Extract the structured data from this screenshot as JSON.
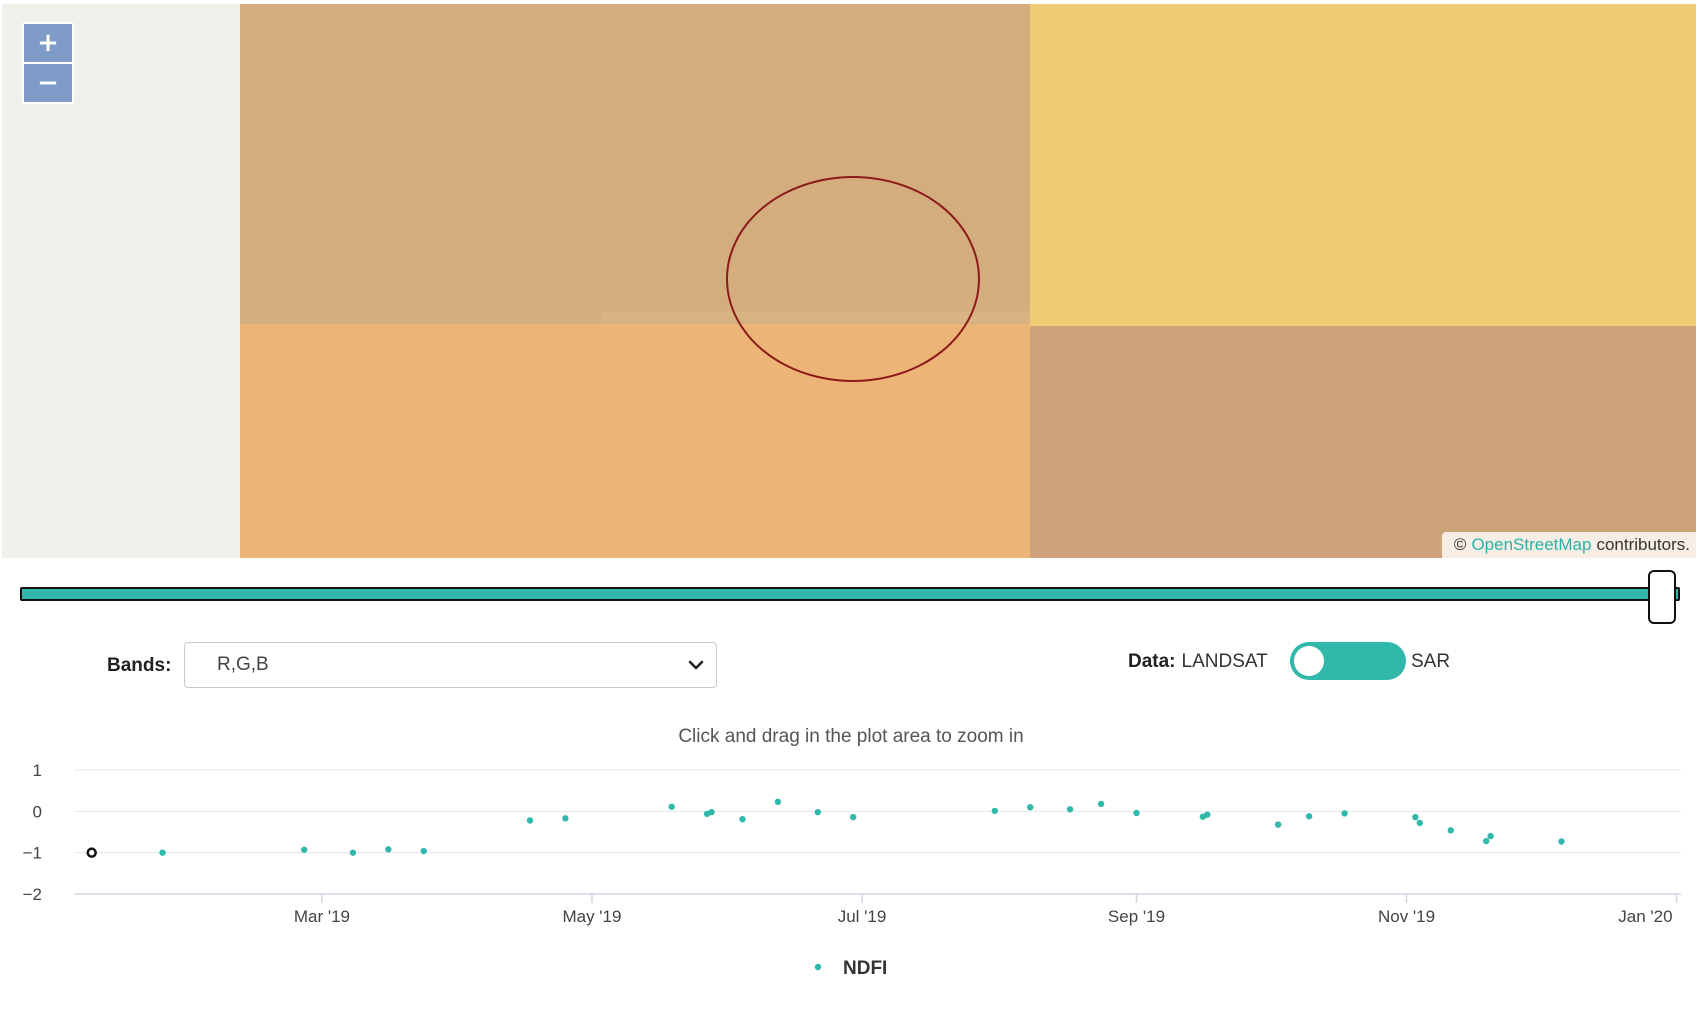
{
  "map": {
    "zoom_in_label": "+",
    "zoom_out_label": "−",
    "attribution": {
      "copyright": "©",
      "link_text": "OpenStreetMap",
      "suffix": "contributors."
    }
  },
  "controls": {
    "bands_label": "Bands:",
    "bands_value": "R,G,B",
    "data_label": "Data:",
    "data_option_left": "LANDSAT",
    "data_option_right": "SAR",
    "data_toggle_on": true
  },
  "colors": {
    "accent": "#30b8aa",
    "aoi_ring": "#8b1a1a",
    "zoom_button": "#7f9bc7"
  },
  "chart_data": {
    "type": "scatter",
    "subtitle": "Click and drag in the plot area to zoom in",
    "y_ticks": [
      "1",
      "0",
      "−1",
      "−2"
    ],
    "ylim": [
      -2,
      1
    ],
    "x_ticks": [
      "Mar '19",
      "May '19",
      "Jul '19",
      "Sep '19",
      "Nov '19",
      "Jan '20"
    ],
    "x_tick_dates": [
      "2019-03-01",
      "2019-05-01",
      "2019-07-01",
      "2019-09-01",
      "2019-11-01",
      "2020-01-01"
    ],
    "xlim": [
      "2019-01-04",
      "2020-01-02"
    ],
    "grid": true,
    "legend_position": "bottom-center",
    "series": [
      {
        "name": "NDFI",
        "color": "#30b8aa",
        "points": [
          {
            "x": "2019-01-08",
            "y": -1.0,
            "selected": true
          },
          {
            "x": "2019-01-24",
            "y": -1.0
          },
          {
            "x": "2019-02-25",
            "y": -0.93
          },
          {
            "x": "2019-03-08",
            "y": -1.0
          },
          {
            "x": "2019-03-16",
            "y": -0.92
          },
          {
            "x": "2019-03-24",
            "y": -0.96
          },
          {
            "x": "2019-04-17",
            "y": -0.22
          },
          {
            "x": "2019-04-25",
            "y": -0.17
          },
          {
            "x": "2019-05-19",
            "y": 0.11
          },
          {
            "x": "2019-05-27",
            "y": -0.06
          },
          {
            "x": "2019-05-28",
            "y": -0.02
          },
          {
            "x": "2019-06-04",
            "y": -0.19
          },
          {
            "x": "2019-06-12",
            "y": 0.23
          },
          {
            "x": "2019-06-21",
            "y": -0.02
          },
          {
            "x": "2019-06-29",
            "y": -0.14
          },
          {
            "x": "2019-07-31",
            "y": 0.01
          },
          {
            "x": "2019-08-08",
            "y": 0.1
          },
          {
            "x": "2019-08-17",
            "y": 0.05
          },
          {
            "x": "2019-08-24",
            "y": 0.18
          },
          {
            "x": "2019-09-01",
            "y": -0.04
          },
          {
            "x": "2019-09-16",
            "y": -0.13
          },
          {
            "x": "2019-09-17",
            "y": -0.08
          },
          {
            "x": "2019-10-03",
            "y": -0.32
          },
          {
            "x": "2019-10-10",
            "y": -0.12
          },
          {
            "x": "2019-10-18",
            "y": -0.05
          },
          {
            "x": "2019-11-03",
            "y": -0.14
          },
          {
            "x": "2019-11-04",
            "y": -0.28
          },
          {
            "x": "2019-11-11",
            "y": -0.46
          },
          {
            "x": "2019-11-19",
            "y": -0.72
          },
          {
            "x": "2019-11-20",
            "y": -0.6
          },
          {
            "x": "2019-12-06",
            "y": -0.73
          }
        ]
      }
    ]
  }
}
